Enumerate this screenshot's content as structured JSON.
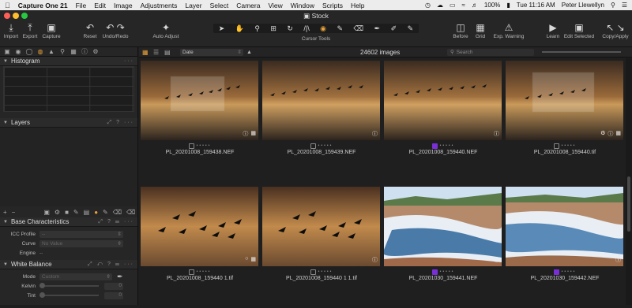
{
  "menubar": {
    "app_name": "Capture One 21",
    "items": [
      "File",
      "Edit",
      "Image",
      "Adjustments",
      "Layer",
      "Select",
      "Camera",
      "View",
      "Window",
      "Scripts",
      "Help"
    ],
    "battery": "100%",
    "clock": "Tue 11:16 AM",
    "user": "Peter Llewellyn"
  },
  "window": {
    "title": "Stock"
  },
  "toolbar": {
    "import": "Import",
    "export": "Export",
    "capture": "Capture",
    "reset": "Reset",
    "undo_redo": "Undo/Redo",
    "auto_adjust": "Auto Adjust",
    "cursor_tools": "Cursor Tools",
    "before": "Before",
    "grid": "Grid",
    "exposure_warning": "Exp. Warning",
    "learn": "Learn",
    "edit_selected": "Edit Selected",
    "copy_apply": "Copy/Apply"
  },
  "panel": {
    "histogram": "Histogram",
    "layers": "Layers",
    "base_characteristics": "Base Characteristics",
    "icc_profile_label": "ICC Profile",
    "icc_profile_value": "--",
    "curve_label": "Curve",
    "curve_value": "No Value",
    "engine_label": "Engine",
    "engine_value": "--",
    "white_balance": "White Balance",
    "mode_label": "Mode",
    "mode_value": "Custom",
    "kelvin_label": "Kelvin",
    "kelvin_value": "0",
    "tint_label": "Tint",
    "tint_value": "0"
  },
  "browser": {
    "sort": "Date",
    "image_count": "24602 images",
    "search_placeholder": "Search",
    "images": [
      {
        "name": "PL_20201008_159438.NEF",
        "scene": "geese-sunset-overlay",
        "color_tag": "none"
      },
      {
        "name": "PL_20201008_159439.NEF",
        "scene": "geese-sunset",
        "color_tag": "none"
      },
      {
        "name": "PL_20201008_159440.NEF",
        "scene": "geese-sunset",
        "color_tag": "purple"
      },
      {
        "name": "PL_20201008_159440.tif",
        "scene": "geese-sunset-overlay",
        "color_tag": "none"
      },
      {
        "name": "PL_20201008_159440 1.tif",
        "scene": "geese-dark",
        "color_tag": "none"
      },
      {
        "name": "PL_20201008_159440 1 1.tif",
        "scene": "geese-dark",
        "color_tag": "none"
      },
      {
        "name": "PL_20201030_159441.NEF",
        "scene": "winter-river",
        "color_tag": "purple"
      },
      {
        "name": "PL_20201030_159442.NEF",
        "scene": "winter-river",
        "color_tag": "purple"
      }
    ]
  }
}
